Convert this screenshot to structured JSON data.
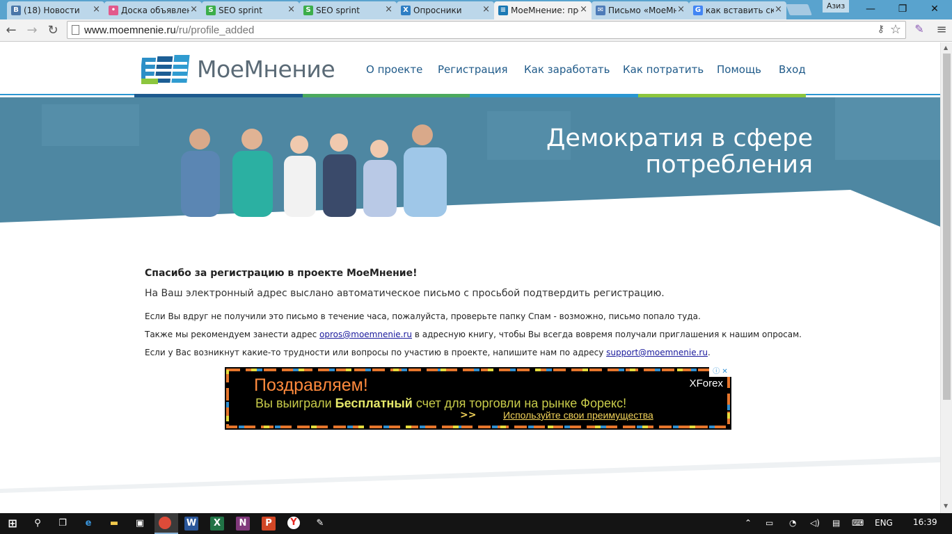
{
  "browser": {
    "tabs": [
      {
        "title": "(18) Новости",
        "icon": "vk-icon",
        "color": "#4a76a8",
        "glyph": "В"
      },
      {
        "title": "Доска объявлений",
        "icon": "board-icon",
        "color": "#e2598c",
        "glyph": "•"
      },
      {
        "title": "SEO sprint",
        "icon": "seosprint-icon",
        "color": "#3cae4a",
        "glyph": "S"
      },
      {
        "title": "SEO sprint",
        "icon": "seosprint-icon",
        "color": "#3cae4a",
        "glyph": "S"
      },
      {
        "title": "Опросники",
        "icon": "survey-icon",
        "color": "#2d7ec4",
        "glyph": "X"
      },
      {
        "title": "МоеМнение: профиль",
        "icon": "moemnenie-icon",
        "color": "#1d79b4",
        "glyph": "≡"
      },
      {
        "title": "Письмо «МоеМнение»",
        "icon": "mail-icon",
        "color": "#4d7bb8",
        "glyph": "✉"
      },
      {
        "title": "как вставить скриншот",
        "icon": "google-icon",
        "color": "#4285f4",
        "glyph": "G"
      }
    ],
    "active_tab": 5,
    "user_name": "Азиз",
    "url_host": "www.moemnenie.ru",
    "url_path": "/ru/profile_added"
  },
  "site": {
    "logo_text": "МоеМнение",
    "nav": [
      "О проекте",
      "Регистрация",
      "Как заработать",
      "Как потратить",
      "Помощь",
      "Вход"
    ],
    "hero_line1": "Демократия в сфере",
    "hero_line2": "потребления"
  },
  "content": {
    "title": "Спасибо за регистрацию в проекте МоеМнение!",
    "subtitle": "На Ваш электронный адрес выслано автоматическое письмо с просьбой подтвердить регистрацию.",
    "line1": "Если Вы вдруг не получили это письмо в течение часа, пожалуйста, проверьте папку Спам - возможно, письмо попало туда.",
    "line2_before": "Также мы рекомендуем занести адрес ",
    "line2_link": "opros@moemnenie.ru",
    "line2_after": " в адресную книгу, чтобы Вы всегда вовремя получали приглашения к нашим опросам.",
    "line3_before": "Если у Вас возникнут какие-то трудности или вопросы по участию в проекте, напишите нам по адресу ",
    "line3_link": "support@moemnenie.ru",
    "line3_after": "."
  },
  "ad": {
    "title": "Поздравляем!",
    "text_before": "Вы выиграли ",
    "text_bold": "Бесплатный",
    "text_after": " счет для торговли на рынке Форекс!",
    "arrows": ">>",
    "link": "Используйте свои преимущества",
    "brand": "XForex",
    "close_glyph": "ⓘ ✕"
  },
  "taskbar": {
    "language": "ENG",
    "time": "16:39"
  }
}
